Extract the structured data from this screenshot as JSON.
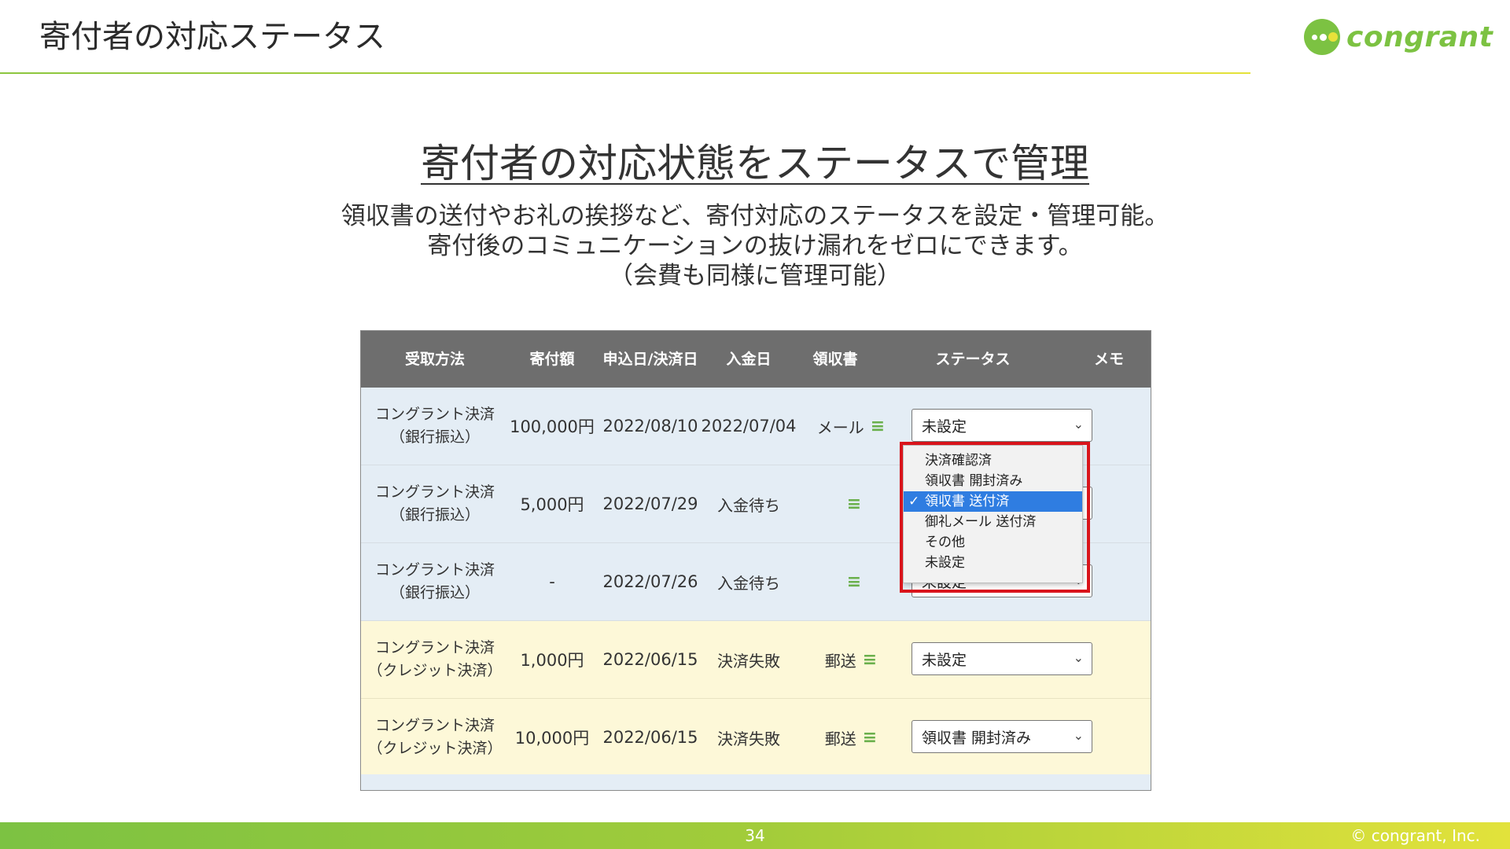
{
  "slide": {
    "title": "寄付者の対応ステータス",
    "logo_text": "congrant",
    "heading": "寄付者の対応状態をステータスで管理",
    "description_lines": [
      "領収書の送付やお礼の挨拶など、寄付対応のステータスを設定・管理可能。",
      "寄付後のコミュニケーションの抜け漏れをゼロにできます。",
      "（会費も同様に管理可能）"
    ],
    "page_number": "34",
    "copyright": "© congrant, Inc."
  },
  "table": {
    "headers": [
      "受取方法",
      "寄付額",
      "申込日/決済日",
      "入金日",
      "領収書",
      "ステータス",
      "メモ"
    ],
    "rows": [
      {
        "method_1": "コングラント決済",
        "method_2": "（銀行振込）",
        "amount": "100,000円",
        "date": "2022/08/10",
        "paid": "2022/07/04",
        "receipt": "メール",
        "status": "未設定",
        "row_color": "blue"
      },
      {
        "method_1": "コングラント決済",
        "method_2": "（銀行振込）",
        "amount": "5,000円",
        "date": "2022/07/29",
        "paid": "入金待ち",
        "receipt": "",
        "status": "",
        "row_color": "blue"
      },
      {
        "method_1": "コングラント決済",
        "method_2": "（銀行振込）",
        "amount": "-",
        "date": "2022/07/26",
        "paid": "入金待ち",
        "receipt": "",
        "status": "未設定",
        "row_color": "blue"
      },
      {
        "method_1": "コングラント決済",
        "method_2": "（クレジット決済）",
        "amount": "1,000円",
        "date": "2022/06/15",
        "paid": "決済失敗",
        "receipt": "郵送",
        "status": "未設定",
        "row_color": "yellow"
      },
      {
        "method_1": "コングラント決済",
        "method_2": "（クレジット決済）",
        "amount": "10,000円",
        "date": "2022/06/15",
        "paid": "決済失敗",
        "receipt": "郵送",
        "status": "領収書 開封済み",
        "row_color": "yellow"
      }
    ],
    "receipt_menu_icon": "menu-icon",
    "select_chevron_icon": "chevron-down-icon"
  },
  "status_dropdown": {
    "options": [
      "決済確認済",
      "領収書 開封済み",
      "領収書 送付済",
      "御礼メール 送付済",
      "その他",
      "未設定"
    ],
    "selected_index": 2,
    "check_mark": "✓",
    "highlight_color": "#d9141b",
    "selected_color": "#2f7de1"
  },
  "colors": {
    "brand_green": "#7cc242",
    "header_gray": "#6e6e6e",
    "row_blue": "#e4edf5",
    "row_yellow": "#fdf8d8"
  }
}
